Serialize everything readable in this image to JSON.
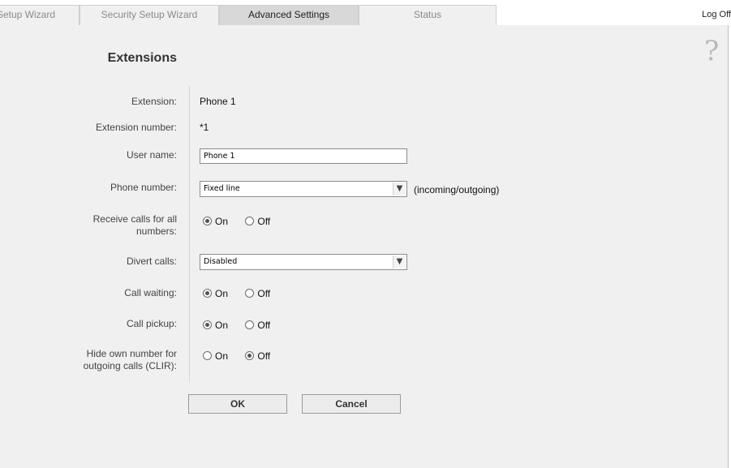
{
  "tabs": [
    {
      "label": "Setup Wizard",
      "active": false
    },
    {
      "label": "Security Setup Wizard",
      "active": false
    },
    {
      "label": "Advanced Settings",
      "active": true
    },
    {
      "label": "Status",
      "active": false
    }
  ],
  "logoff": "Log Off",
  "help_glyph": "?",
  "page_title": "Extensions",
  "fields": {
    "extension": {
      "label": "Extension:",
      "value": "Phone 1"
    },
    "extension_number": {
      "label": "Extension number:",
      "value": "*1"
    },
    "user_name": {
      "label": "User name:",
      "value": "Phone 1"
    },
    "phone_number": {
      "label": "Phone number:",
      "value": "Fixed line",
      "suffix": "(incoming/outgoing)"
    },
    "receive_calls": {
      "label_line1": "Receive calls for all",
      "label_line2": "numbers:",
      "on": "On",
      "off": "Off",
      "selected": "On"
    },
    "divert_calls": {
      "label": "Divert calls:",
      "value": "Disabled"
    },
    "call_waiting": {
      "label": "Call waiting:",
      "on": "On",
      "off": "Off",
      "selected": "On"
    },
    "call_pickup": {
      "label": "Call pickup:",
      "on": "On",
      "off": "Off",
      "selected": "On"
    },
    "clir": {
      "label_line1": "Hide own number for",
      "label_line2": "outgoing calls (CLIR):",
      "on": "On",
      "off": "Off",
      "selected": "Off"
    }
  },
  "buttons": {
    "ok": "OK",
    "cancel": "Cancel"
  },
  "colors": {
    "content_bg": "#f0f0f0",
    "active_tab_bg": "#d8d8d8"
  }
}
